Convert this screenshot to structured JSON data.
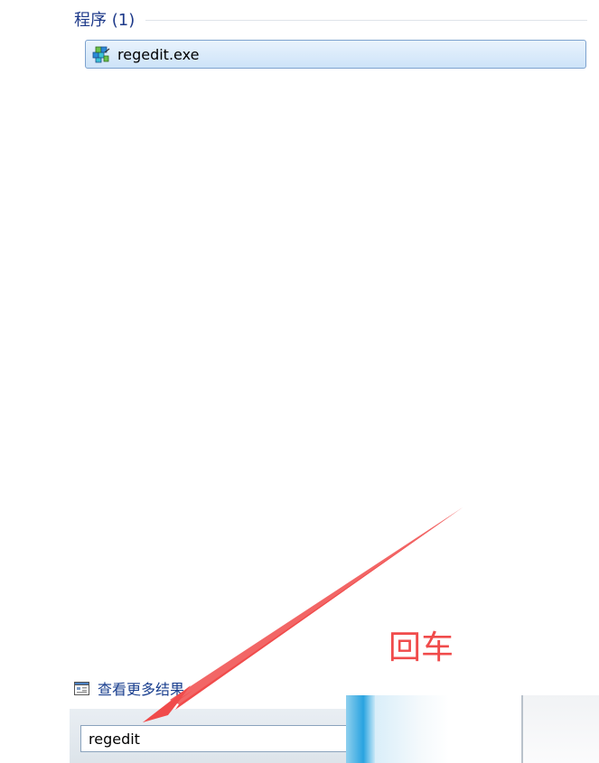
{
  "section": {
    "title": "程序 (1)"
  },
  "results": [
    {
      "label": "regedit.exe",
      "icon": "regedit-icon"
    }
  ],
  "more_results": {
    "label": "查看更多结果",
    "icon": "more-results-icon"
  },
  "search": {
    "value": "regedit",
    "clear_symbol": "×"
  },
  "annotation": {
    "text": "回车",
    "color": "#f04b4b"
  },
  "colors": {
    "accent": "#1e3a8a",
    "selection_border": "#7da2ce",
    "annotation": "#f04b4b"
  }
}
